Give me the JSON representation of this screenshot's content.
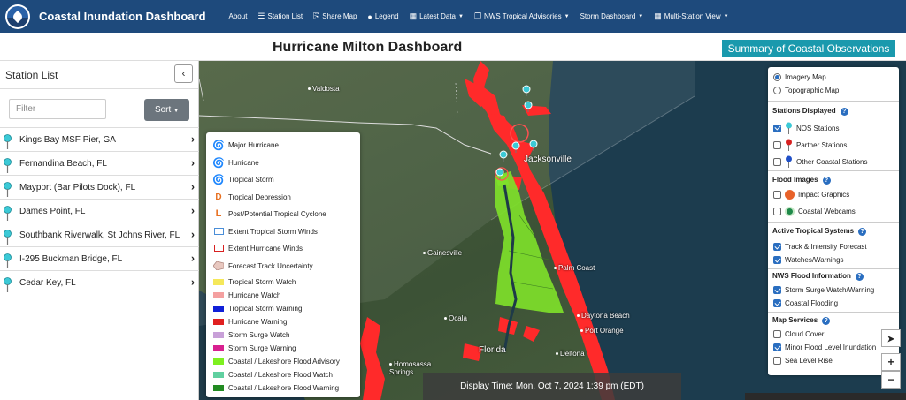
{
  "header": {
    "app_title": "Coastal Inundation Dashboard",
    "nav": [
      {
        "label": "About",
        "icon": "none",
        "dropdown": false
      },
      {
        "label": "Station List",
        "icon": "list-icon",
        "dropdown": false
      },
      {
        "label": "Share Map",
        "icon": "share-icon",
        "dropdown": false
      },
      {
        "label": "Legend",
        "icon": "legend-pin-icon",
        "dropdown": false
      },
      {
        "label": "Latest Data",
        "icon": "table-icon",
        "dropdown": true
      },
      {
        "label": "NWS Tropical Advisories",
        "icon": "copy-icon",
        "dropdown": true
      },
      {
        "label": "Storm Dashboard",
        "icon": "none",
        "dropdown": true
      },
      {
        "label": "Multi-Station View",
        "icon": "table-icon",
        "dropdown": true
      }
    ]
  },
  "title_bar": {
    "page_title": "Hurricane Milton Dashboard",
    "summary_button": "Summary of Coastal Observations"
  },
  "sidebar": {
    "title": "Station List",
    "collapse_label": "‹",
    "filter_placeholder": "Filter",
    "sort_label": "Sort",
    "stations": [
      "Kings Bay MSF Pier, GA",
      "Fernandina Beach, FL",
      "Mayport (Bar Pilots Dock), FL",
      "Dames Point, FL",
      "Southbank Riverwalk, St Johns River, FL",
      "I-295 Buckman Bridge, FL",
      "Cedar Key, FL"
    ]
  },
  "map": {
    "places": [
      "Valdosta",
      "Jacksonville",
      "Gainesville",
      "Palm Coast",
      "Ocala",
      "Daytona Beach",
      "Port Orange",
      "Florida",
      "Deltona",
      "Homosassa Springs"
    ],
    "display_time": "Display Time: Mon, Oct 7, 2024 1:39 pm (EDT)",
    "zoom_in": "+",
    "zoom_out": "−",
    "locate_icon": "locate-arrow-icon",
    "colors": {
      "flood": "#ff2a2a",
      "advisory": "#7ee02a",
      "land": "#3f5a3a",
      "water": "#1e3a4a"
    }
  },
  "legend": {
    "items": [
      {
        "label": "Major Hurricane",
        "symbol": "major-hurricane-icon",
        "color": "#d33"
      },
      {
        "label": "Hurricane",
        "symbol": "hurricane-icon",
        "color": "#e85a2a"
      },
      {
        "label": "Tropical Storm",
        "symbol": "tropical-storm-icon",
        "color": "#d04020"
      },
      {
        "label": "Tropical Depression",
        "symbol": "tropical-depression-icon",
        "color": "#e87020"
      },
      {
        "label": "Post/Potential Tropical Cyclone",
        "symbol": "post-tropical-icon",
        "color": "#e87020"
      },
      {
        "label": "Extent Tropical Storm Winds",
        "symbol": "ts-winds-box",
        "color": "#4a8ed8"
      },
      {
        "label": "Extent Hurricane Winds",
        "symbol": "hurricane-winds-box",
        "color": "#d82020"
      },
      {
        "label": "Forecast Track Uncertainty",
        "symbol": "cone-icon",
        "color": "#e8c8c0"
      },
      {
        "label": "Tropical Storm Watch",
        "symbol": "swatch",
        "color": "#f5e85a"
      },
      {
        "label": "Hurricane Watch",
        "symbol": "swatch",
        "color": "#f4a0a0"
      },
      {
        "label": "Tropical Storm Warning",
        "symbol": "swatch",
        "color": "#1020d8"
      },
      {
        "label": "Hurricane Warning",
        "symbol": "swatch",
        "color": "#e02020"
      },
      {
        "label": "Storm Surge Watch",
        "symbol": "swatch",
        "color": "#c8a0d8"
      },
      {
        "label": "Storm Surge Warning",
        "symbol": "swatch",
        "color": "#d82090"
      },
      {
        "label": "Coastal / Lakeshore Flood Advisory",
        "symbol": "swatch",
        "color": "#7ef020"
      },
      {
        "label": "Coastal / Lakeshore Flood Watch",
        "symbol": "swatch",
        "color": "#60d0a0"
      },
      {
        "label": "Coastal / Lakeshore Flood Warning",
        "symbol": "swatch",
        "color": "#228b22"
      }
    ]
  },
  "layer_panel": {
    "basemap": [
      {
        "label": "Imagery Map",
        "selected": true
      },
      {
        "label": "Topographic Map",
        "selected": false
      }
    ],
    "sections": [
      {
        "title": "Stations Displayed",
        "items": [
          {
            "label": "NOS Stations",
            "checked": true,
            "icon": "teal-pin-icon"
          },
          {
            "label": "Partner Stations",
            "checked": false,
            "icon": "red-pin-icon"
          },
          {
            "label": "Other Coastal Stations",
            "checked": false,
            "icon": "blue-pin-icon"
          }
        ]
      },
      {
        "title": "Flood Images",
        "items": [
          {
            "label": "Impact Graphics",
            "checked": false,
            "icon": "impact-graphics-icon"
          },
          {
            "label": "Coastal Webcams",
            "checked": false,
            "icon": "webcam-icon"
          }
        ]
      },
      {
        "title": "Active Tropical Systems",
        "items": [
          {
            "label": "Track & Intensity Forecast",
            "checked": true
          },
          {
            "label": "Watches/Warnings",
            "checked": true
          }
        ]
      },
      {
        "title": "NWS Flood Information",
        "items": [
          {
            "label": "Storm Surge Watch/Warning",
            "checked": true
          },
          {
            "label": "Coastal Flooding",
            "checked": true
          }
        ]
      },
      {
        "title": "Map Services",
        "items": [
          {
            "label": "Cloud Cover",
            "checked": false
          },
          {
            "label": "Minor Flood Level Inundation",
            "checked": true
          },
          {
            "label": "Sea Level Rise",
            "checked": false
          }
        ]
      }
    ]
  }
}
